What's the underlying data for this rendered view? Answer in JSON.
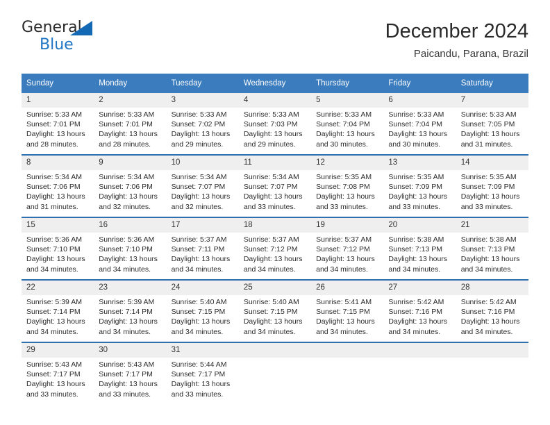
{
  "brand": {
    "name_part1": "General",
    "name_part2": "Blue",
    "triangle_icon": "brand-triangle-icon",
    "colors": {
      "dark": "#2b2b2b",
      "blue": "#2076c4",
      "triangle": "#1469b4"
    }
  },
  "header": {
    "title": "December 2024",
    "subtitle": "Paicandu, Parana, Brazil"
  },
  "theme": {
    "header_row_bg": "#3a7cbe",
    "row_divider": "#2f6fae",
    "daynum_bg": "#efefef",
    "text": "#2b2b2b"
  },
  "weekdays": [
    "Sunday",
    "Monday",
    "Tuesday",
    "Wednesday",
    "Thursday",
    "Friday",
    "Saturday"
  ],
  "weeks": [
    [
      {
        "day": "1",
        "sunrise": "Sunrise: 5:33 AM",
        "sunset": "Sunset: 7:01 PM",
        "daylight1": "Daylight: 13 hours",
        "daylight2": "and 28 minutes."
      },
      {
        "day": "2",
        "sunrise": "Sunrise: 5:33 AM",
        "sunset": "Sunset: 7:01 PM",
        "daylight1": "Daylight: 13 hours",
        "daylight2": "and 28 minutes."
      },
      {
        "day": "3",
        "sunrise": "Sunrise: 5:33 AM",
        "sunset": "Sunset: 7:02 PM",
        "daylight1": "Daylight: 13 hours",
        "daylight2": "and 29 minutes."
      },
      {
        "day": "4",
        "sunrise": "Sunrise: 5:33 AM",
        "sunset": "Sunset: 7:03 PM",
        "daylight1": "Daylight: 13 hours",
        "daylight2": "and 29 minutes."
      },
      {
        "day": "5",
        "sunrise": "Sunrise: 5:33 AM",
        "sunset": "Sunset: 7:04 PM",
        "daylight1": "Daylight: 13 hours",
        "daylight2": "and 30 minutes."
      },
      {
        "day": "6",
        "sunrise": "Sunrise: 5:33 AM",
        "sunset": "Sunset: 7:04 PM",
        "daylight1": "Daylight: 13 hours",
        "daylight2": "and 30 minutes."
      },
      {
        "day": "7",
        "sunrise": "Sunrise: 5:33 AM",
        "sunset": "Sunset: 7:05 PM",
        "daylight1": "Daylight: 13 hours",
        "daylight2": "and 31 minutes."
      }
    ],
    [
      {
        "day": "8",
        "sunrise": "Sunrise: 5:34 AM",
        "sunset": "Sunset: 7:06 PM",
        "daylight1": "Daylight: 13 hours",
        "daylight2": "and 31 minutes."
      },
      {
        "day": "9",
        "sunrise": "Sunrise: 5:34 AM",
        "sunset": "Sunset: 7:06 PM",
        "daylight1": "Daylight: 13 hours",
        "daylight2": "and 32 minutes."
      },
      {
        "day": "10",
        "sunrise": "Sunrise: 5:34 AM",
        "sunset": "Sunset: 7:07 PM",
        "daylight1": "Daylight: 13 hours",
        "daylight2": "and 32 minutes."
      },
      {
        "day": "11",
        "sunrise": "Sunrise: 5:34 AM",
        "sunset": "Sunset: 7:07 PM",
        "daylight1": "Daylight: 13 hours",
        "daylight2": "and 33 minutes."
      },
      {
        "day": "12",
        "sunrise": "Sunrise: 5:35 AM",
        "sunset": "Sunset: 7:08 PM",
        "daylight1": "Daylight: 13 hours",
        "daylight2": "and 33 minutes."
      },
      {
        "day": "13",
        "sunrise": "Sunrise: 5:35 AM",
        "sunset": "Sunset: 7:09 PM",
        "daylight1": "Daylight: 13 hours",
        "daylight2": "and 33 minutes."
      },
      {
        "day": "14",
        "sunrise": "Sunrise: 5:35 AM",
        "sunset": "Sunset: 7:09 PM",
        "daylight1": "Daylight: 13 hours",
        "daylight2": "and 33 minutes."
      }
    ],
    [
      {
        "day": "15",
        "sunrise": "Sunrise: 5:36 AM",
        "sunset": "Sunset: 7:10 PM",
        "daylight1": "Daylight: 13 hours",
        "daylight2": "and 34 minutes."
      },
      {
        "day": "16",
        "sunrise": "Sunrise: 5:36 AM",
        "sunset": "Sunset: 7:10 PM",
        "daylight1": "Daylight: 13 hours",
        "daylight2": "and 34 minutes."
      },
      {
        "day": "17",
        "sunrise": "Sunrise: 5:37 AM",
        "sunset": "Sunset: 7:11 PM",
        "daylight1": "Daylight: 13 hours",
        "daylight2": "and 34 minutes."
      },
      {
        "day": "18",
        "sunrise": "Sunrise: 5:37 AM",
        "sunset": "Sunset: 7:12 PM",
        "daylight1": "Daylight: 13 hours",
        "daylight2": "and 34 minutes."
      },
      {
        "day": "19",
        "sunrise": "Sunrise: 5:37 AM",
        "sunset": "Sunset: 7:12 PM",
        "daylight1": "Daylight: 13 hours",
        "daylight2": "and 34 minutes."
      },
      {
        "day": "20",
        "sunrise": "Sunrise: 5:38 AM",
        "sunset": "Sunset: 7:13 PM",
        "daylight1": "Daylight: 13 hours",
        "daylight2": "and 34 minutes."
      },
      {
        "day": "21",
        "sunrise": "Sunrise: 5:38 AM",
        "sunset": "Sunset: 7:13 PM",
        "daylight1": "Daylight: 13 hours",
        "daylight2": "and 34 minutes."
      }
    ],
    [
      {
        "day": "22",
        "sunrise": "Sunrise: 5:39 AM",
        "sunset": "Sunset: 7:14 PM",
        "daylight1": "Daylight: 13 hours",
        "daylight2": "and 34 minutes."
      },
      {
        "day": "23",
        "sunrise": "Sunrise: 5:39 AM",
        "sunset": "Sunset: 7:14 PM",
        "daylight1": "Daylight: 13 hours",
        "daylight2": "and 34 minutes."
      },
      {
        "day": "24",
        "sunrise": "Sunrise: 5:40 AM",
        "sunset": "Sunset: 7:15 PM",
        "daylight1": "Daylight: 13 hours",
        "daylight2": "and 34 minutes."
      },
      {
        "day": "25",
        "sunrise": "Sunrise: 5:40 AM",
        "sunset": "Sunset: 7:15 PM",
        "daylight1": "Daylight: 13 hours",
        "daylight2": "and 34 minutes."
      },
      {
        "day": "26",
        "sunrise": "Sunrise: 5:41 AM",
        "sunset": "Sunset: 7:15 PM",
        "daylight1": "Daylight: 13 hours",
        "daylight2": "and 34 minutes."
      },
      {
        "day": "27",
        "sunrise": "Sunrise: 5:42 AM",
        "sunset": "Sunset: 7:16 PM",
        "daylight1": "Daylight: 13 hours",
        "daylight2": "and 34 minutes."
      },
      {
        "day": "28",
        "sunrise": "Sunrise: 5:42 AM",
        "sunset": "Sunset: 7:16 PM",
        "daylight1": "Daylight: 13 hours",
        "daylight2": "and 34 minutes."
      }
    ],
    [
      {
        "day": "29",
        "sunrise": "Sunrise: 5:43 AM",
        "sunset": "Sunset: 7:17 PM",
        "daylight1": "Daylight: 13 hours",
        "daylight2": "and 33 minutes."
      },
      {
        "day": "30",
        "sunrise": "Sunrise: 5:43 AM",
        "sunset": "Sunset: 7:17 PM",
        "daylight1": "Daylight: 13 hours",
        "daylight2": "and 33 minutes."
      },
      {
        "day": "31",
        "sunrise": "Sunrise: 5:44 AM",
        "sunset": "Sunset: 7:17 PM",
        "daylight1": "Daylight: 13 hours",
        "daylight2": "and 33 minutes."
      },
      {
        "day": "",
        "sunrise": "",
        "sunset": "",
        "daylight1": "",
        "daylight2": ""
      },
      {
        "day": "",
        "sunrise": "",
        "sunset": "",
        "daylight1": "",
        "daylight2": ""
      },
      {
        "day": "",
        "sunrise": "",
        "sunset": "",
        "daylight1": "",
        "daylight2": ""
      },
      {
        "day": "",
        "sunrise": "",
        "sunset": "",
        "daylight1": "",
        "daylight2": ""
      }
    ]
  ]
}
